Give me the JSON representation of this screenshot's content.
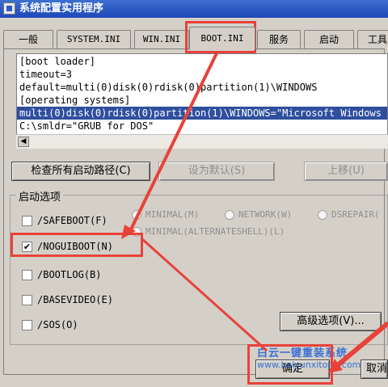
{
  "window": {
    "title": "系统配置实用程序"
  },
  "tabs": [
    {
      "label": "一般"
    },
    {
      "label": "SYSTEM.INI"
    },
    {
      "label": "WIN.INI"
    },
    {
      "label": "BOOT.INI"
    },
    {
      "label": "服务"
    },
    {
      "label": "启动"
    },
    {
      "label": "工具"
    }
  ],
  "editor": {
    "lines": [
      "[boot loader]",
      "timeout=3",
      "default=multi(0)disk(0)rdisk(0)partition(1)\\WINDOWS",
      "[operating systems]",
      "multi(0)disk(0)rdisk(0)partition(1)\\WINDOWS=\"Microsoft Windows",
      "C:\\smldr=\"GRUB for DOS\""
    ]
  },
  "buttons": {
    "check_all": "检查所有启动路径(C)",
    "set_default": "设为默认(S)",
    "move_up": "上移(U)",
    "advanced": "高级选项(V)...",
    "ok": "确定",
    "cancel": "取消"
  },
  "boot_options": {
    "group_title": "启动选项",
    "checkboxes": [
      {
        "label": "/SAFEBOOT(F)",
        "checked": false
      },
      {
        "label": "/NOGUIBOOT(N)",
        "checked": true
      },
      {
        "label": "/BOOTLOG(B)",
        "checked": false
      },
      {
        "label": "/BASEVIDEO(E)",
        "checked": false
      },
      {
        "label": "/SOS(O)",
        "checked": false
      }
    ],
    "radios": [
      {
        "label": "MINIMAL(M)"
      },
      {
        "label": "NETWORK(W)"
      },
      {
        "label": "DSREPAIR("
      },
      {
        "label": "MINIMAL(ALTERNATESHELL)(L)"
      }
    ]
  },
  "watermark": {
    "text": "白云一键重装系统",
    "url": "www.baiyunxitong.com"
  },
  "colors": {
    "highlight": "#e8423a",
    "selection": "#2f4f9e",
    "watermark": "#3a6fd6"
  }
}
